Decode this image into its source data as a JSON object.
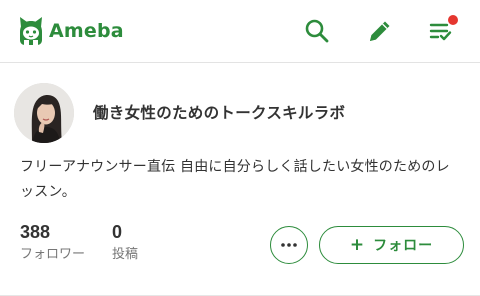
{
  "header": {
    "brand": "Ameba",
    "icons": [
      "ameba-logo-icon",
      "search-icon",
      "pencil-icon",
      "checklist-icon"
    ],
    "has_notification": true,
    "colors": {
      "brand": "#2d8c3c",
      "notification": "#e5362f"
    }
  },
  "profile": {
    "blog_title": "働き女性のためのトークスキルラボ",
    "description": "フリーアナウンサー直伝 自由に自分らしく話したい女性のためのレッスン。",
    "stats": {
      "followers_count": "388",
      "followers_label": "フォロワー",
      "posts_count": "0",
      "posts_label": "投稿"
    },
    "follow_button": {
      "plus": "+",
      "label": "フォロー"
    },
    "more_button_icon": "ellipsis-icon"
  }
}
